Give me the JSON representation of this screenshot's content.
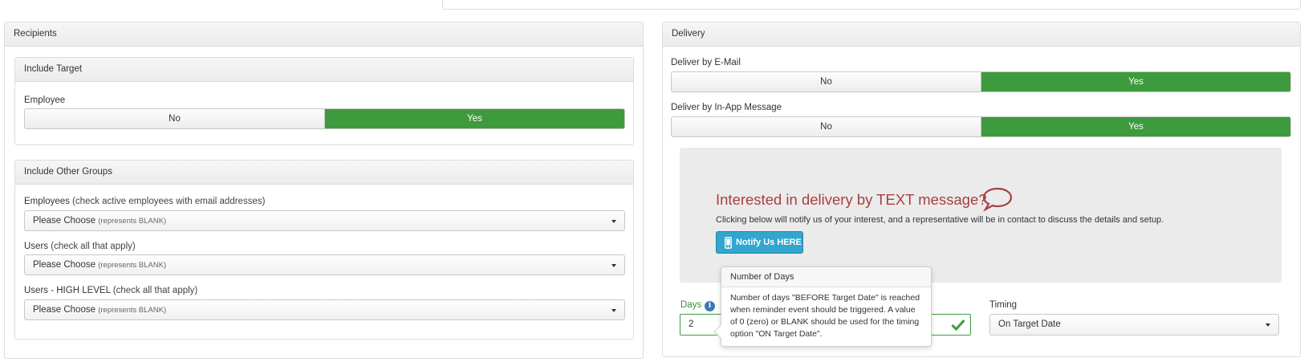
{
  "recipients": {
    "title": "Recipients",
    "include_target": {
      "title": "Include Target",
      "employee_label": "Employee",
      "no_label": "No",
      "yes_label": "Yes",
      "selected": "Yes"
    },
    "include_other_groups": {
      "title": "Include Other Groups",
      "employees": {
        "label": "Employees",
        "hint": "(check active employees with email addresses)",
        "value": "Please Choose",
        "value_hint": "(represents BLANK)"
      },
      "users": {
        "label": "Users",
        "hint": "(check all that apply)",
        "value": "Please Choose",
        "value_hint": "(represents BLANK)"
      },
      "users_high": {
        "label": "Users - HIGH LEVEL",
        "hint": "(check all that apply)",
        "value": "Please Choose",
        "value_hint": "(represents BLANK)"
      }
    }
  },
  "delivery": {
    "title": "Delivery",
    "email": {
      "label": "Deliver by E-Mail",
      "no_label": "No",
      "yes_label": "Yes",
      "selected": "Yes"
    },
    "inapp": {
      "label": "Deliver by In-App Message",
      "no_label": "No",
      "yes_label": "Yes",
      "selected": "Yes"
    },
    "text_promo": {
      "title": "Interested in delivery by TEXT message?",
      "description": "Clicking below will notify us of your interest, and a representative will be in contact to discuss the details and setup.",
      "button_label": "Notify Us HERE"
    },
    "days": {
      "label": "Days",
      "value": "2"
    },
    "timing": {
      "label": "Timing",
      "value": "On Target Date"
    },
    "popover": {
      "title": "Number of Days",
      "body": "Number of days \"BEFORE Target Date\" is reached when reminder event should be triggered. A value of 0 (zero) or BLANK should be used for the timing option \"ON Target Date\"."
    }
  },
  "colors": {
    "yes_active": "#3d9a3d",
    "notify_button": "#32a6cf",
    "promo_title": "#a8403f",
    "info_icon": "#3a78b5"
  },
  "icons": [
    "speech-bubble-icon",
    "mobile-phone-icon",
    "info-icon",
    "checkmark-icon",
    "chevron-down-icon"
  ]
}
